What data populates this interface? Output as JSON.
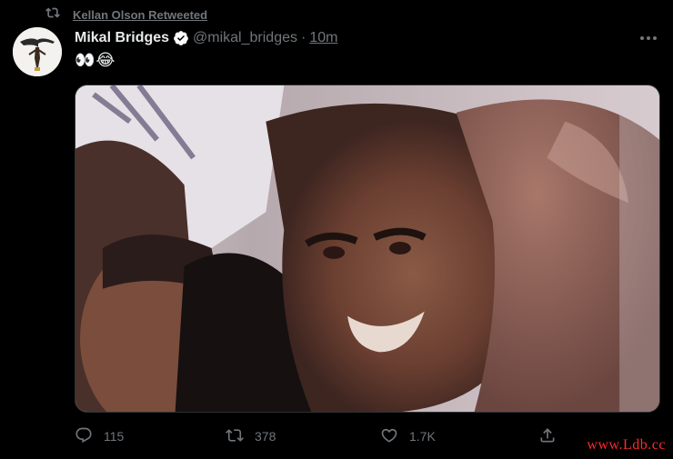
{
  "retweet": {
    "label": "Kellan Olson Retweeted",
    "icon": "retweet-icon"
  },
  "author": {
    "name": "Mikal Bridges",
    "handle": "@mikal_bridges",
    "separator": "·",
    "time": "10m",
    "verified": true
  },
  "tweet": {
    "text": "👀😂"
  },
  "media": {
    "description_icon": "photo"
  },
  "actions": {
    "reply_count": "115",
    "retweet_count": "378",
    "like_count": "1.7K"
  },
  "watermark": "www.Ldb.cc",
  "colors": {
    "background": "#000000",
    "muted": "#71767b",
    "text": "#e7e9ea",
    "verified": "#ffffff"
  }
}
